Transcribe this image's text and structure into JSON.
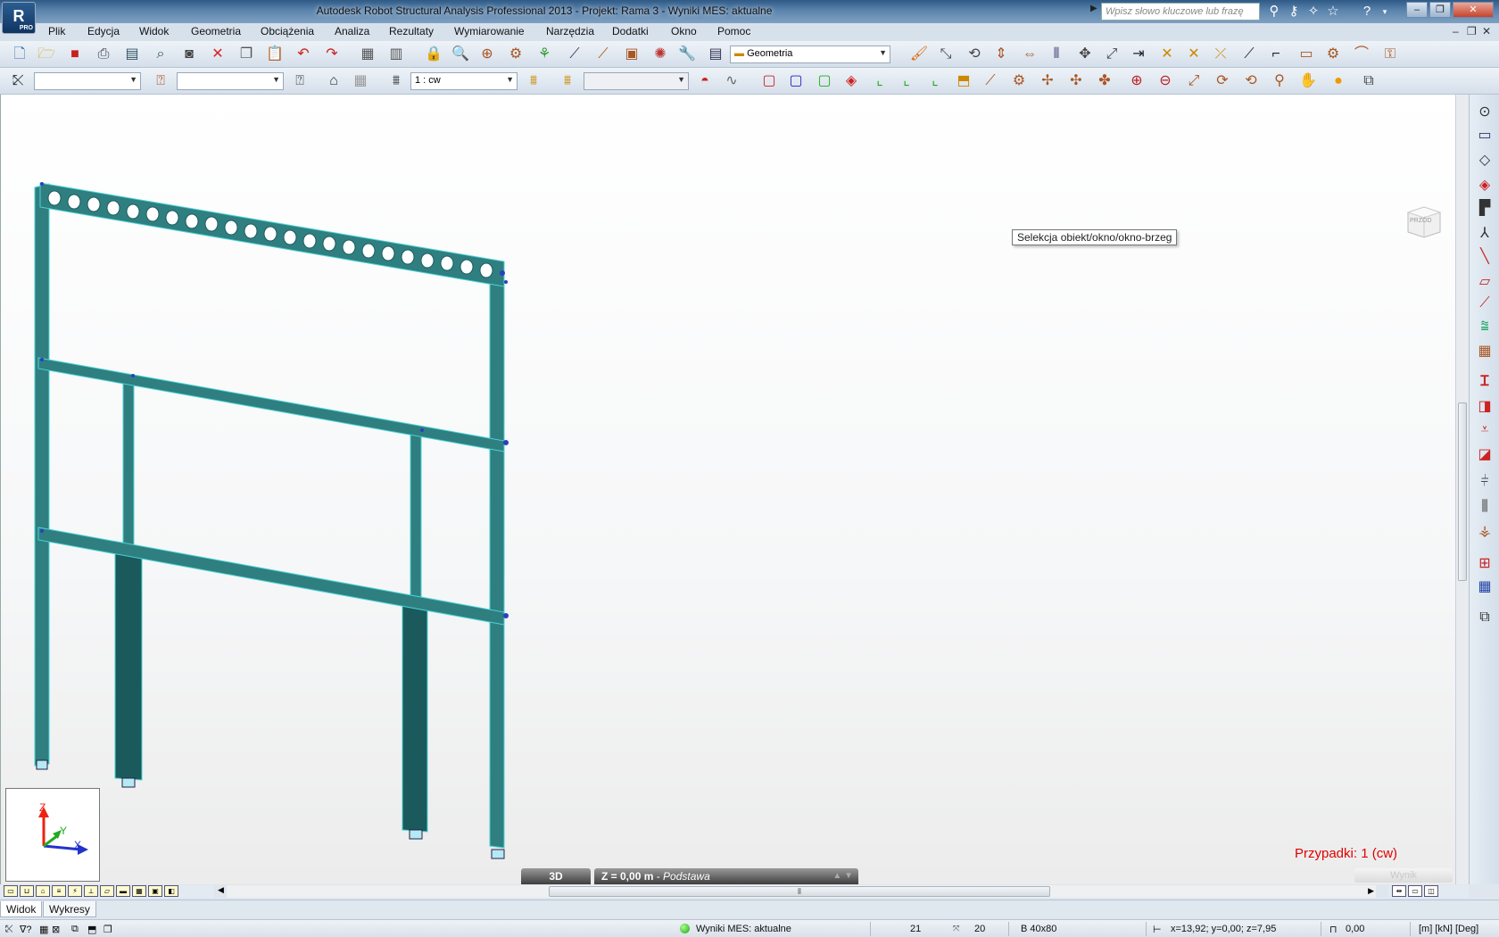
{
  "window": {
    "title": "Autodesk Robot Structural Analysis Professional 2013 - Projekt: Rama 3 - Wyniki MES: aktualne",
    "logo_text": "R",
    "logo_badge": "PRO",
    "search_placeholder": "Wpisz słowo kluczowe lub frazę",
    "controls": [
      "‒",
      "❐",
      "✕"
    ]
  },
  "menu": {
    "items": [
      "Plik",
      "Edycja",
      "Widok",
      "Geometria",
      "Obciążenia",
      "Analiza",
      "Rezultaty",
      "Wymiarowanie",
      "Narzędzia",
      "Dodatki",
      "Okno",
      "Pomoc"
    ],
    "mdi_controls": [
      "‒",
      "❐",
      "✕"
    ]
  },
  "toolbar1": {
    "layout_combo": "Geometria"
  },
  "toolbar2": {
    "node_combo": "",
    "section_combo": "",
    "case_combo": "1 : cw",
    "disabled_combo": ""
  },
  "viewport": {
    "tooltip": "Selekcja obiekt/okno/okno-brzeg",
    "cases_label": "Przypadki: 1 (cw)",
    "view_tab_3d": "3D",
    "view_tab_level": "Z = 0,00 m",
    "view_tab_level_sep": " - ",
    "view_tab_level_name": "Podstawa",
    "ghost_button": "Wynik",
    "view_cube_label": "PRZÓD",
    "axes": {
      "z": "Z",
      "y": "Y",
      "x": "X"
    }
  },
  "tabs": [
    "Widok",
    "Wykresy"
  ],
  "status": {
    "fem_status": "Wyniki MES: aktualne",
    "nodes": "21",
    "bars": "20",
    "section": "B 40x80",
    "coords": "x=13,92; y=0,00; z=7,95",
    "angle": "0,00",
    "units": "[m] [kN] [Deg]"
  },
  "colors": {
    "beam": "#2f7f80",
    "beam_dark": "#1b5a5c",
    "beam_edge": "#49d3d6",
    "cases_red": "#e00000"
  }
}
